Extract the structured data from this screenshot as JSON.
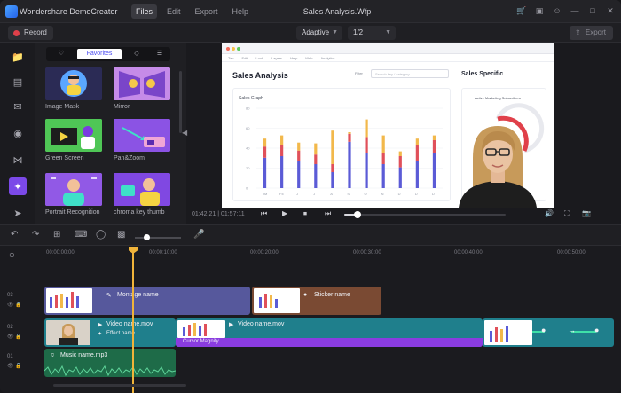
{
  "app": {
    "name": "Wondershare DemoCreator",
    "document_title": "Sales Analysis.Wfp",
    "menu": [
      "Files",
      "Edit",
      "Export",
      "Help"
    ],
    "active_menu": "Files"
  },
  "toolbar": {
    "record_label": "Record",
    "quality_dropdown": "Adaptive",
    "ratio_dropdown": "1/2",
    "export_label": "Export"
  },
  "library": {
    "active_tab": "Favorites",
    "cards": [
      {
        "label": "Image Mask"
      },
      {
        "label": "Mirror"
      },
      {
        "label": "Green Screen"
      },
      {
        "label": "Pan&Zoom"
      },
      {
        "label": "Portrait Recognition"
      },
      {
        "label": "chroma key thumb"
      }
    ]
  },
  "preview": {
    "screen": {
      "nav": [
        "Tab",
        "Edit",
        "Look",
        "Layers",
        "Help",
        "Web",
        "Analytics",
        "..."
      ],
      "title": "Sales Analysis",
      "filter_label": "Filter",
      "filter_placeholder": "Search key / category",
      "specific_title": "Sales Specific",
      "graph_title": "Sales Graph",
      "spec_card_title": "Active Marketing Subscribers",
      "y_ticks": [
        "80",
        "60",
        "40",
        "20",
        "0"
      ],
      "x_ticks": [
        "JM",
        "FE",
        "J",
        "J",
        "A",
        "S",
        "O",
        "N",
        "D",
        "D",
        "D"
      ]
    },
    "timecode": "01:42:21 | 01:57:11",
    "progress_fraction": 0.08
  },
  "timeline": {
    "ruler": [
      "00:00:00:00",
      "00:00:10:00",
      "00:00:20:00",
      "00:00:30:00",
      "00:00:40:00",
      "00:00:50:00"
    ],
    "tracks": {
      "t03": "03",
      "t02": "02",
      "t01": "01"
    },
    "clips": {
      "montage": "Montage name",
      "sticker": "Sticker name",
      "video1": "Video name.mov",
      "video1_effect": "Effect name",
      "video2": "Video name.mov",
      "cursor": "Cursor Magnify",
      "music": "Music name.mp3"
    },
    "zoom_fraction": 0.25
  },
  "colors": {
    "accent": "#7b49e8",
    "bar_blue": "#5b5bd6",
    "bar_red": "#e0505a",
    "bar_yellow": "#f2b84b",
    "clip_purple": "#56589c",
    "clip_brown": "#7a4a33",
    "clip_teal": "#1f7f8c",
    "clip_green": "#1e6b48"
  }
}
